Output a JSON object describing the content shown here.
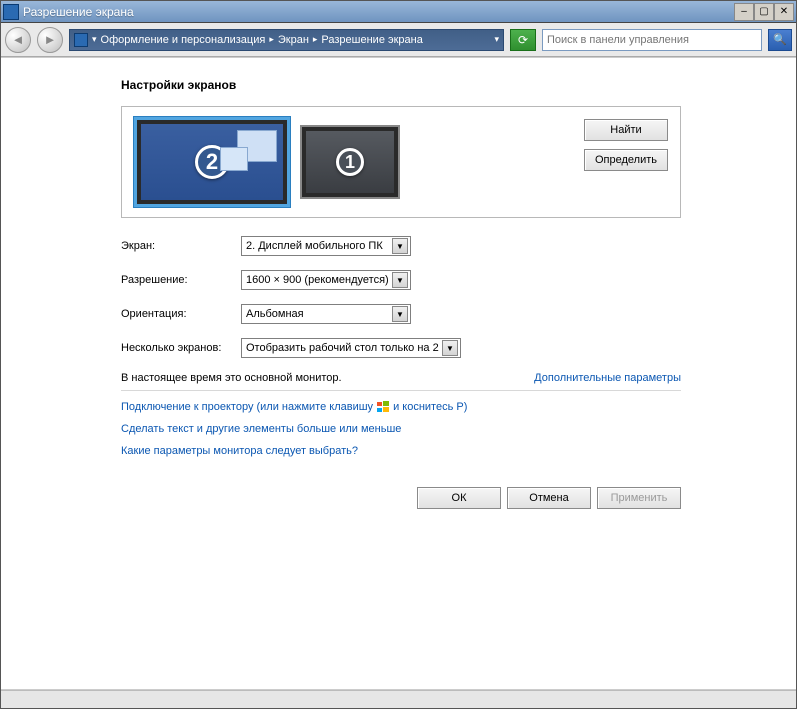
{
  "window": {
    "title": "Разрешение экрана"
  },
  "breadcrumb": {
    "seg1": "Оформление и персонализация",
    "seg2": "Экран",
    "seg3": "Разрешение экрана"
  },
  "search": {
    "placeholder": "Поиск в панели управления"
  },
  "page": {
    "heading": "Настройки экранов"
  },
  "monitors": {
    "btn_find": "Найти",
    "btn_identify": "Определить",
    "m1_num": "1",
    "m2_num": "2"
  },
  "form": {
    "screen_label": "Экран:",
    "screen_value": "2. Дисплей мобильного ПК",
    "resolution_label": "Разрешение:",
    "resolution_value": "1600 × 900 (рекомендуется)",
    "orientation_label": "Ориентация:",
    "orientation_value": "Альбомная",
    "multimon_label": "Несколько экранов:",
    "multimon_value": "Отобразить рабочий стол только на 2"
  },
  "info": {
    "primary": "В настоящее время это основной монитор.",
    "advanced": "Дополнительные параметры"
  },
  "links": {
    "projector_a": "Подключение к проектору (или нажмите клавишу",
    "projector_b": "и коснитесь P)",
    "textsize": "Сделать текст и другие элементы больше или меньше",
    "which": "Какие параметры монитора следует выбрать?"
  },
  "buttons": {
    "ok": "ОК",
    "cancel": "Отмена",
    "apply": "Применить"
  }
}
